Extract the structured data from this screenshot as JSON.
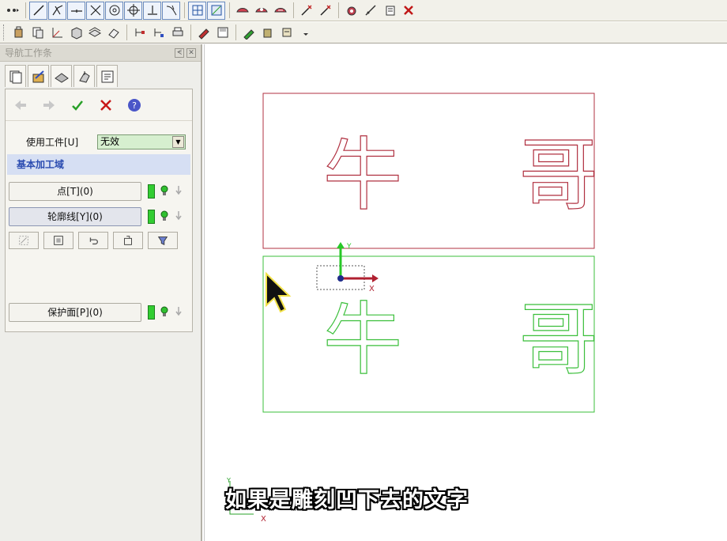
{
  "navigator": {
    "title": "导航工作条",
    "use_workpiece_label": "使用工件[U]",
    "use_workpiece_value": "无效",
    "section_label": "基本加工域",
    "point_button": "点[T](0)",
    "contour_button": "轮廓线[Y](0)",
    "protect_button": "保护面[P](0)"
  },
  "toolbar": {
    "row1_icons": [
      "move-icon",
      "line-icon",
      "curve-icon",
      "arc-icon",
      "cross-icon",
      "circle-icon",
      "target-icon",
      "offset-icon",
      "trim-icon",
      "grid-icon",
      "surface-icon",
      "shape-icon",
      "shape2-icon",
      "shape3-icon",
      "cut-icon",
      "cut2-icon",
      "measure-icon",
      "tool-icon",
      "note-icon",
      "delete-icon"
    ],
    "row2_icons": [
      "part-icon",
      "copy-icon",
      "axis-icon",
      "box-icon",
      "layer-icon",
      "eraser-icon",
      "node-icon",
      "node2-icon",
      "print-icon",
      "color-icon",
      "save-icon",
      "pen-icon",
      "tool2-icon",
      "tool3-icon",
      "dropdown-icon"
    ]
  },
  "canvas": {
    "top_text": "牛  哥",
    "bottom_text": "牛  哥",
    "axis_y_label": "Y",
    "axis_x_label": "X",
    "corner_y_label": "Y",
    "corner_x_label": "X"
  },
  "subtitle": "如果是雕刻凹下去的文字",
  "colors": {
    "top_rect": "#b03040",
    "bottom_rect": "#3bbf3b",
    "y_axis": "#28c828",
    "x_axis": "#b02030",
    "section_bg": "#d6dff3"
  }
}
